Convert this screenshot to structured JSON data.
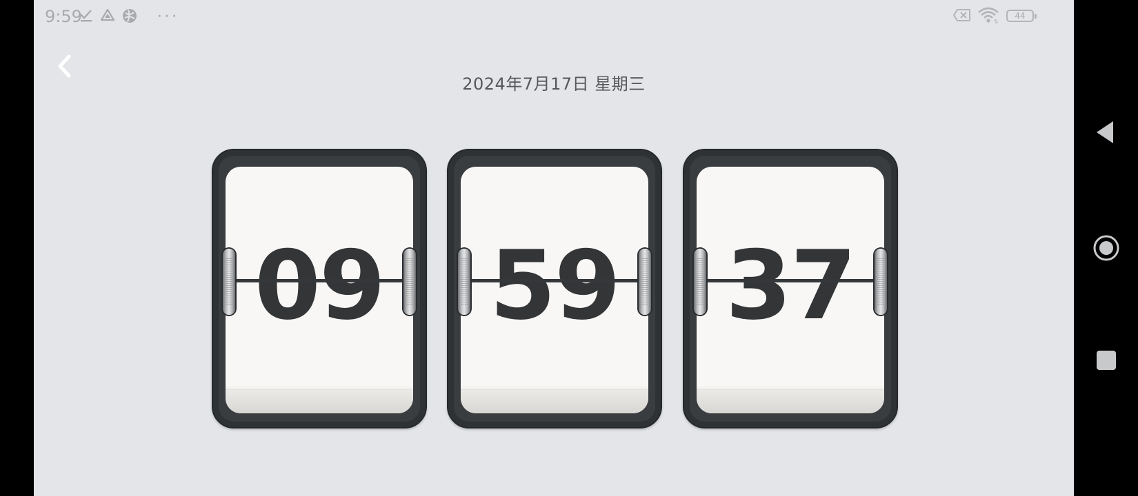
{
  "status_bar": {
    "time": "9:59",
    "battery_level": "44",
    "icons": [
      "download-done-icon",
      "drive-icon",
      "vpn-icon",
      "more-dots-icon",
      "no-sim-icon",
      "wifi-icon",
      "battery-icon"
    ],
    "dots": "···"
  },
  "header": {
    "back_icon": "chevron-left-icon",
    "date": "2024年7月17日  星期三"
  },
  "clock": {
    "hours": "09",
    "minutes": "59",
    "seconds": "37"
  },
  "colors": {
    "background": "#e4e5e9",
    "card_frame": "#3a3d40",
    "card_face": "#f8f7f5",
    "digit": "#333537"
  },
  "nav_bar": {
    "buttons": [
      "back-triangle-icon",
      "home-circle-icon",
      "recents-square-icon"
    ]
  }
}
